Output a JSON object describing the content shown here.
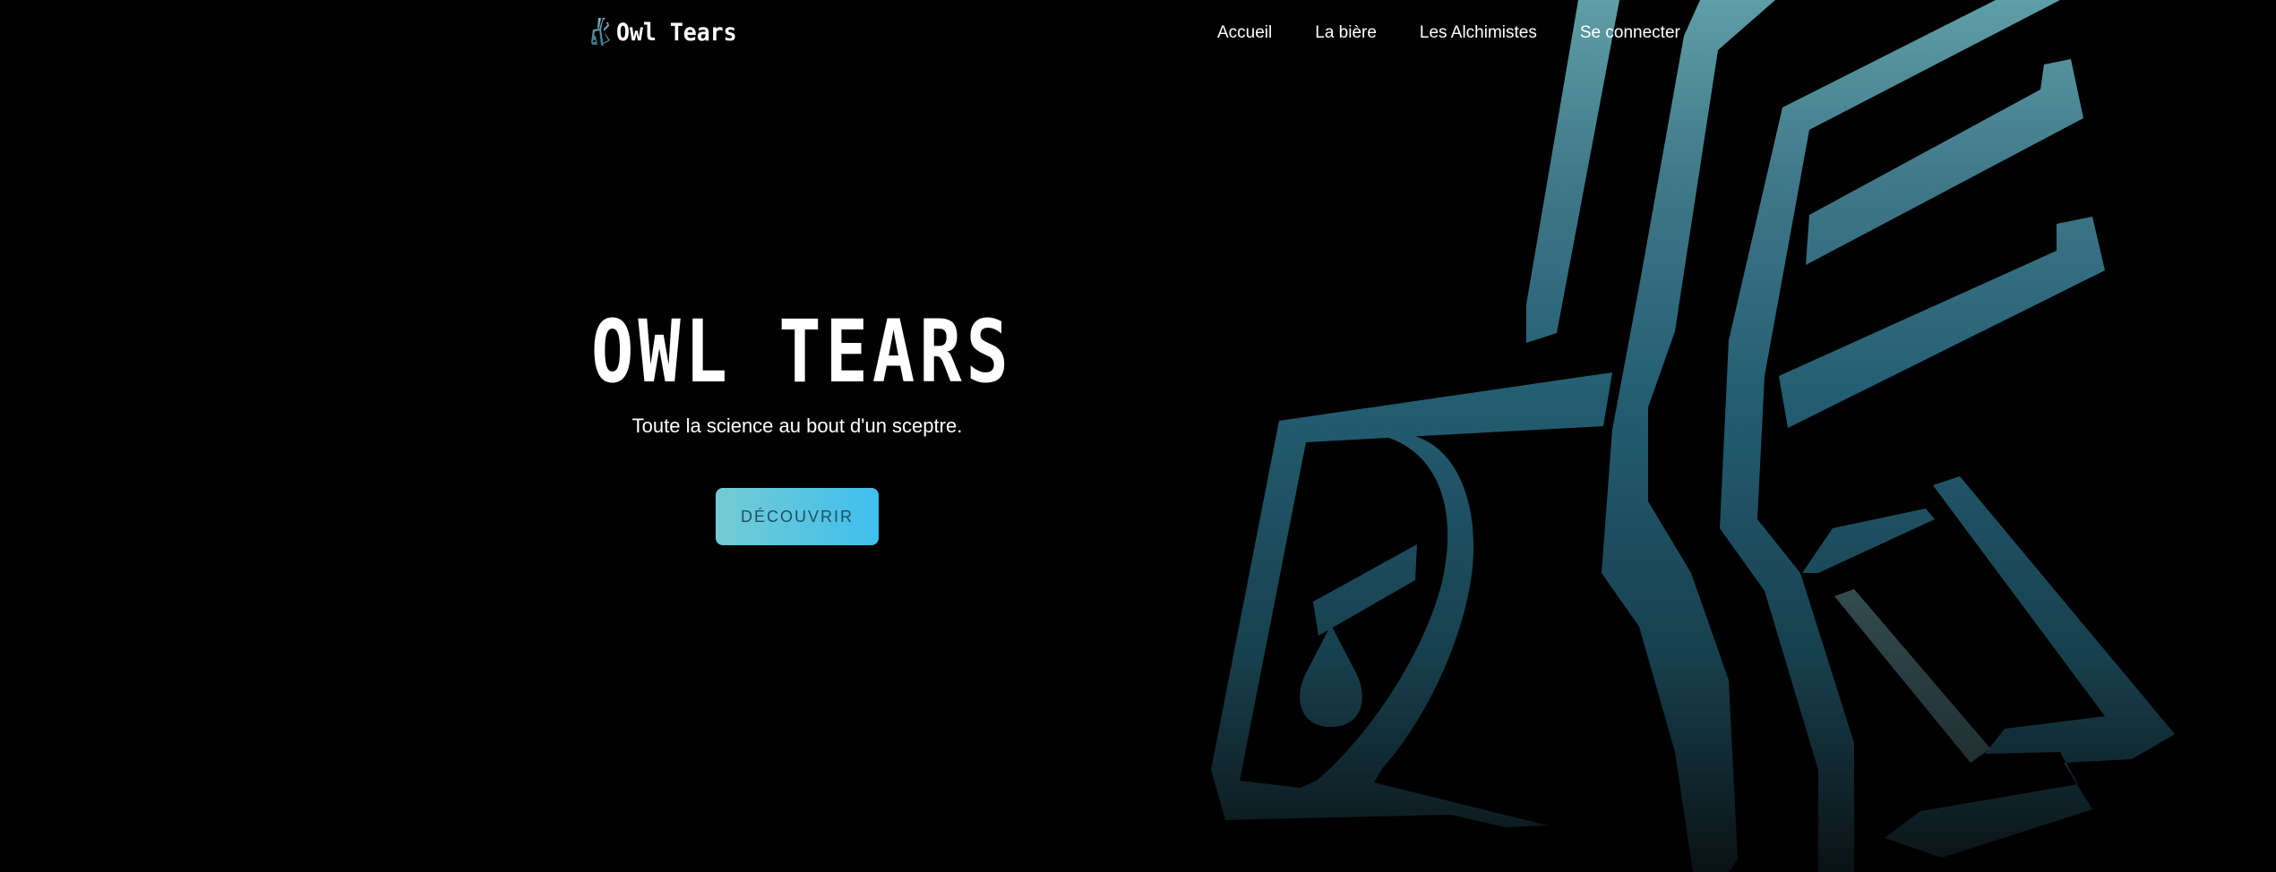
{
  "brand": {
    "name": "Owl Tears",
    "icon": "owl-logo-icon"
  },
  "nav": {
    "items": [
      {
        "label": "Accueil"
      },
      {
        "label": "La bière"
      },
      {
        "label": "Les Alchimistes"
      },
      {
        "label": "Se connecter"
      }
    ]
  },
  "hero": {
    "title": "OWL TEARS",
    "subtitle": "Toute la science au bout d'un sceptre.",
    "cta_label": "DÉCOUVRIR",
    "art_icon": "owl-tear-artwork"
  },
  "colors": {
    "background": "#000000",
    "text": "#ffffff",
    "accent_start": "#74cbd2",
    "accent_end": "#3fbfee",
    "art_top": "#5a9aa3",
    "art_mid": "#235d72",
    "art_bottom": "#0b1416"
  }
}
